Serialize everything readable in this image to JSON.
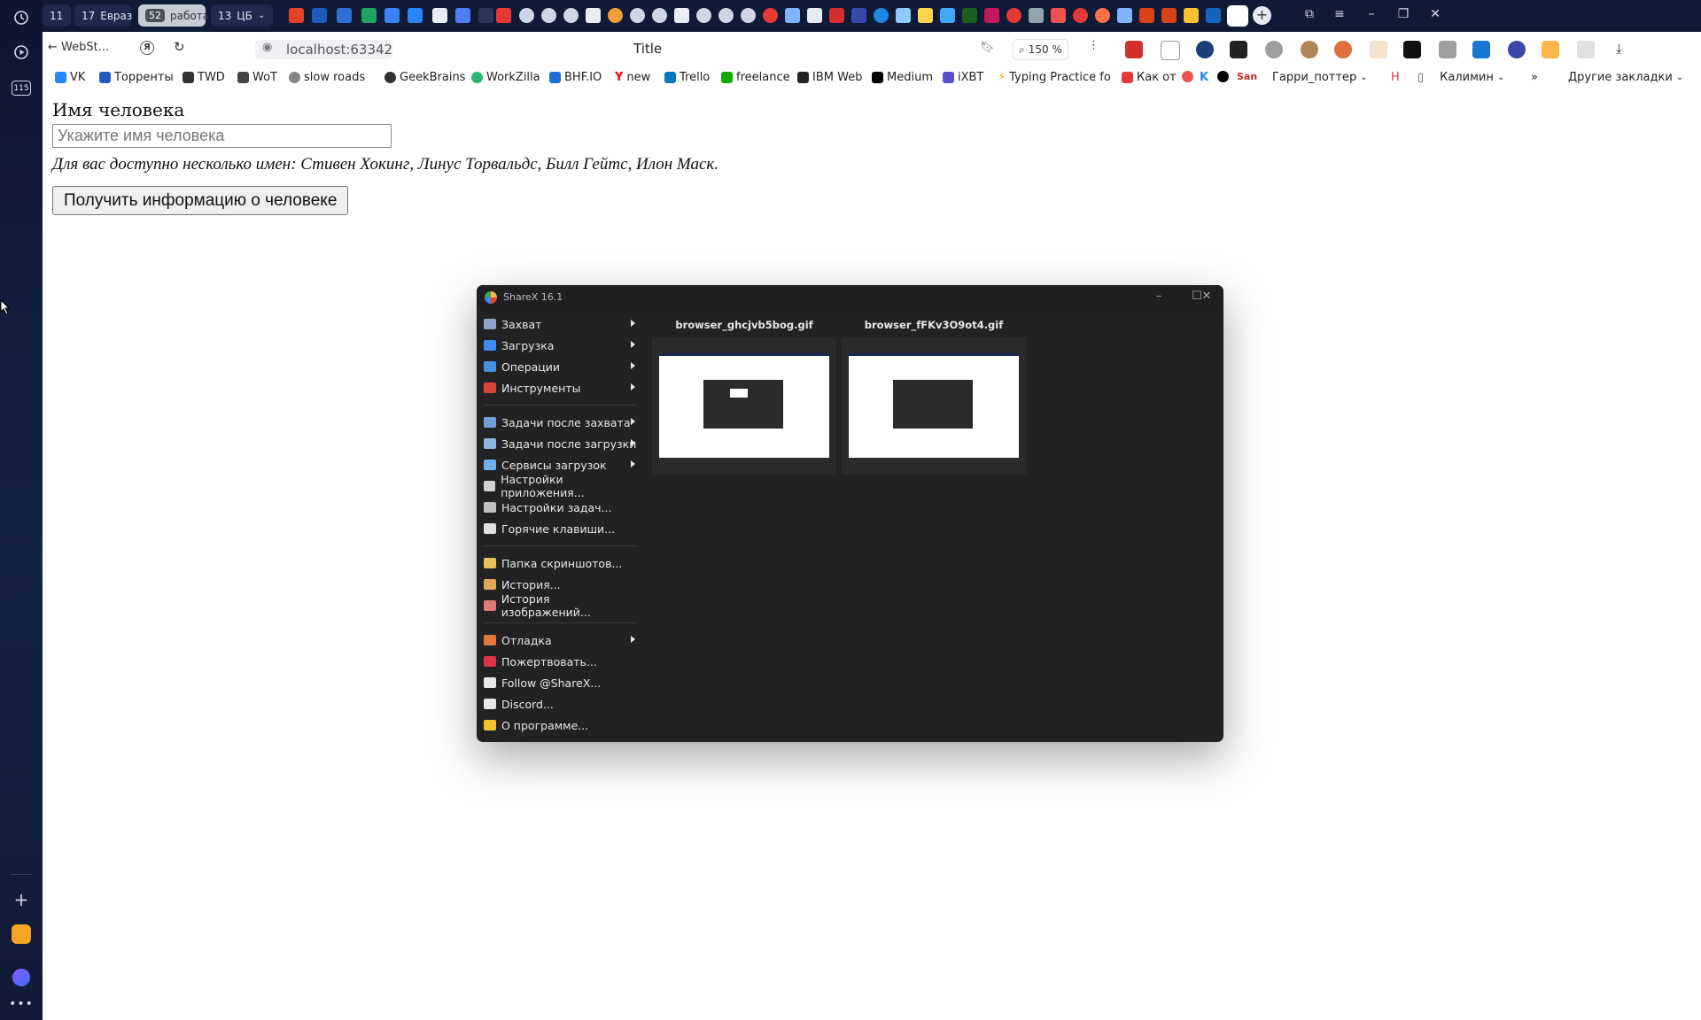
{
  "tabs": {
    "groups": [
      {
        "num": "11",
        "label": ""
      },
      {
        "num": "17",
        "label": "Евраз"
      },
      {
        "num": "52",
        "label": "работа"
      },
      {
        "num": "13",
        "label": "ЦБ"
      }
    ]
  },
  "address_bar": {
    "back_label": "WebSt...",
    "url": "localhost:63342",
    "page_title": "Title",
    "zoom": "150 %"
  },
  "bookmarks": [
    {
      "label": "VK",
      "color": "#2787f5"
    },
    {
      "label": "Торренты",
      "color": "#1e5bbf"
    },
    {
      "label": "TWD",
      "color": "#333333"
    },
    {
      "label": "WoT",
      "color": "#444444"
    },
    {
      "label": "slow roads",
      "color": "#777777"
    },
    {
      "label": "GeekBrains",
      "color": "#333333"
    },
    {
      "label": "WorkZilla",
      "color": "#2bb673"
    },
    {
      "label": "BHF.IO",
      "color": "#1c6fd1"
    },
    {
      "label": "new",
      "color": "#ff0000"
    },
    {
      "label": "Trello",
      "color": "#0079bf"
    },
    {
      "label": "freelance",
      "color": "#14a800"
    },
    {
      "label": "IBM Web",
      "color": "#222222"
    },
    {
      "label": "Medium",
      "color": "#000000"
    },
    {
      "label": "iXBT",
      "color": "#5a4fcf"
    },
    {
      "label": "Typing Practice fo",
      "color": "#f2a900"
    },
    {
      "label": "Как от",
      "color": "#e53935"
    },
    {
      "label": "Гарри_поттер",
      "color": "#c62828"
    },
    {
      "label": "Калимин",
      "color": "#555555"
    },
    {
      "label": "Другие закладки",
      "color": "#555555"
    }
  ],
  "page": {
    "label": "Имя человека",
    "input_placeholder": "Укажите имя человека",
    "input_value": "",
    "hint": "Для вас доступно несколько имен: Стивен Хокинг, Линус Торвальдс, Билл Гейтс, Илон Маск.",
    "button": "Получить информацию о человеке"
  },
  "sharex": {
    "title": "ShareX 16.1",
    "menu_groups": [
      [
        {
          "label": "Захват",
          "icon": "capture-icon",
          "color": "#8fa3c7",
          "submenu": true
        },
        {
          "label": "Загрузка",
          "icon": "upload-icon",
          "color": "#3d8df0",
          "submenu": true
        },
        {
          "label": "Операции",
          "icon": "workflows-icon",
          "color": "#4a90e2",
          "submenu": true
        },
        {
          "label": "Инструменты",
          "icon": "tools-icon",
          "color": "#d9463b",
          "submenu": true
        }
      ],
      [
        {
          "label": "Задачи после захвата",
          "icon": "after-capture-icon",
          "color": "#6fa0d8",
          "submenu": true
        },
        {
          "label": "Задачи после загрузки",
          "icon": "after-upload-icon",
          "color": "#8fb4e0",
          "submenu": true
        },
        {
          "label": "Сервисы загрузок",
          "icon": "destinations-icon",
          "color": "#6fb0e8",
          "submenu": true
        },
        {
          "label": "Настройки приложения...",
          "icon": "app-settings-icon",
          "color": "#d0d0d0",
          "submenu": false
        },
        {
          "label": "Настройки задач...",
          "icon": "task-settings-icon",
          "color": "#c0c0c0",
          "submenu": false
        },
        {
          "label": "Горячие клавиши...",
          "icon": "hotkeys-icon",
          "color": "#e0e0e0",
          "submenu": false
        }
      ],
      [
        {
          "label": "Папка скриншотов...",
          "icon": "folder-icon",
          "color": "#e8c15a",
          "submenu": false
        },
        {
          "label": "История...",
          "icon": "history-icon",
          "color": "#e0a85a",
          "submenu": false
        },
        {
          "label": "История изображений...",
          "icon": "image-history-icon",
          "color": "#e07a7a",
          "submenu": false
        }
      ],
      [
        {
          "label": "Отладка",
          "icon": "debug-icon",
          "color": "#e8763c",
          "submenu": true
        },
        {
          "label": "Пожертвовать...",
          "icon": "heart-icon",
          "color": "#e0334c",
          "submenu": false
        },
        {
          "label": "Follow @ShareX...",
          "icon": "x-logo-icon",
          "color": "#e8e8e8",
          "submenu": false
        },
        {
          "label": "Discord...",
          "icon": "discord-icon",
          "color": "#e8e8e8",
          "submenu": false
        },
        {
          "label": "О программе...",
          "icon": "crown-icon",
          "color": "#f2c230",
          "submenu": false
        }
      ]
    ],
    "thumbnails": [
      {
        "name": "browser_ghcjvb5bog.gif"
      },
      {
        "name": "browser_fFKv3O9ot4.gif"
      }
    ]
  }
}
